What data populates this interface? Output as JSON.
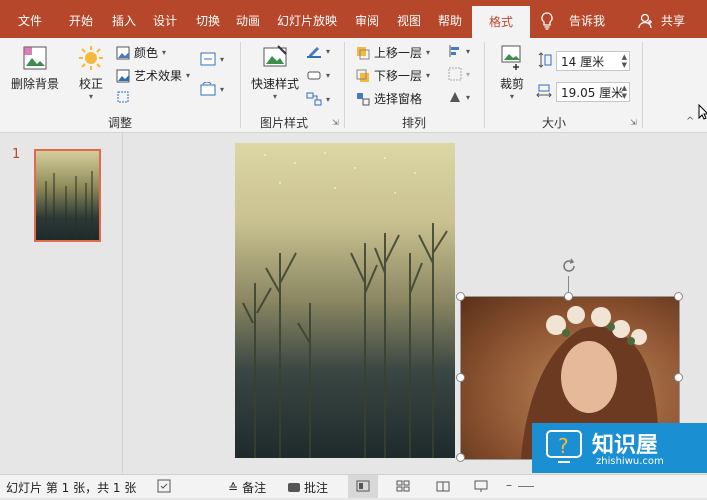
{
  "tabs": [
    "文件",
    "开始",
    "插入",
    "设计",
    "切换",
    "动画",
    "幻灯片放映",
    "审阅",
    "视图",
    "帮助",
    "格式"
  ],
  "tell_me": "告诉我",
  "share": "共享",
  "ribbon": {
    "remove_bg": "删除背景",
    "correct": "校正",
    "color": "颜色",
    "artistic": "艺术效果",
    "adjust_group": "调整",
    "quick_styles": "快速样式",
    "picture_styles_group": "图片样式",
    "bring_forward": "上移一层",
    "send_backward": "下移一层",
    "selection_pane": "选择窗格",
    "arrange_group": "排列",
    "crop": "裁剪",
    "height": "14 厘米",
    "width": "19.05 厘米",
    "size_group": "大小"
  },
  "thumbnail": {
    "number": "1"
  },
  "status": {
    "slide_info": "幻灯片 第 1 张，共 1 张",
    "notes": "备注",
    "comments": "批注"
  },
  "watermark": {
    "brand": "知识屋",
    "url": "zhishiwu.com"
  },
  "colors": {
    "accent": "#b7472a",
    "ribbon_bg": "#f3f3f3"
  }
}
